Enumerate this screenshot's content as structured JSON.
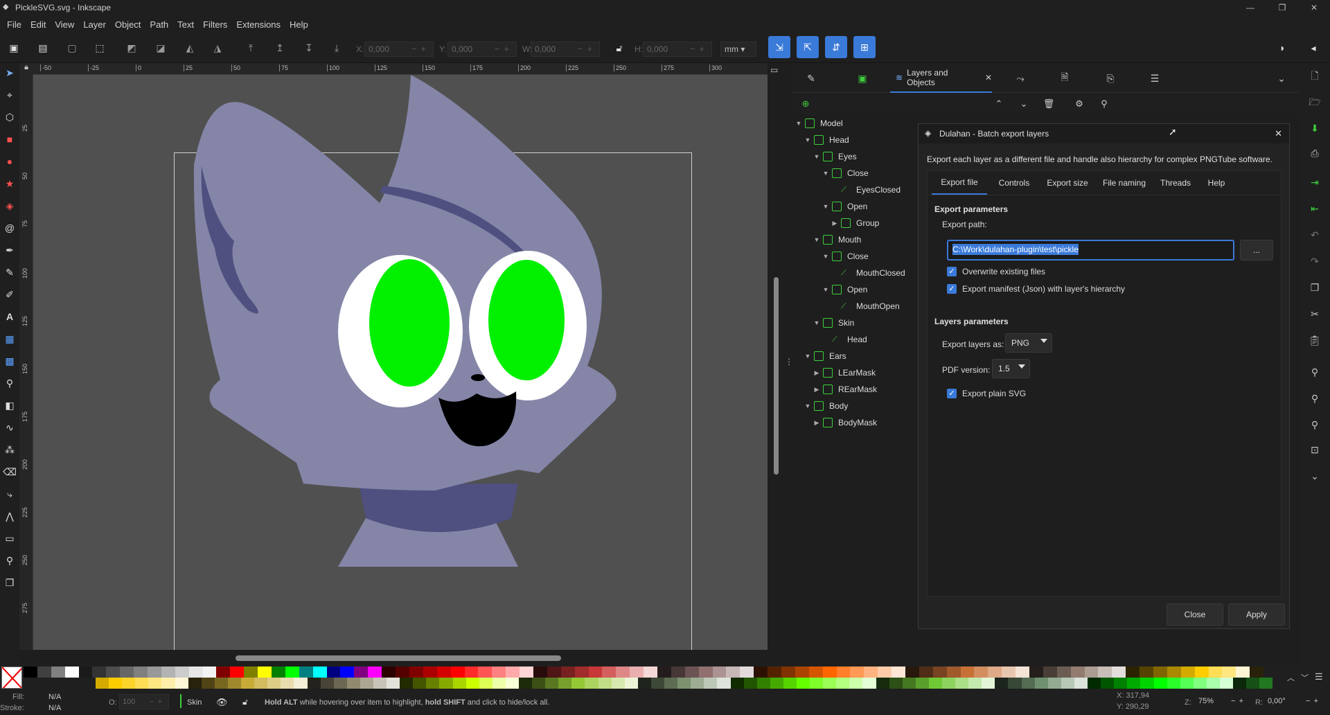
{
  "window": {
    "title": "PickleSVG.svg - Inkscape",
    "minimize": "—",
    "maximize": "❐",
    "close": "✕"
  },
  "menu": [
    "File",
    "Edit",
    "View",
    "Layer",
    "Object",
    "Path",
    "Text",
    "Filters",
    "Extensions",
    "Help"
  ],
  "toolbar": {
    "x_label": "X:",
    "x_value": "0,000",
    "y_label": "Y:",
    "y_value": "0,000",
    "w_label": "W:",
    "w_value": "0,000",
    "h_label": "H:",
    "h_value": "0,000",
    "units": "mm"
  },
  "ruler": {
    "top": [
      "-50",
      "-25",
      "0",
      "25",
      "50",
      "75",
      "100",
      "125",
      "150",
      "175",
      "200",
      "225",
      "250",
      "275",
      "300"
    ],
    "left": [
      "25",
      "50",
      "75",
      "100",
      "125",
      "150",
      "175",
      "200",
      "225",
      "250",
      "275"
    ]
  },
  "dock": {
    "tab_label": "Layers and Objects",
    "tab_close": "✕"
  },
  "tree": [
    {
      "label": "Model",
      "depth": 0,
      "arrow": "open",
      "kind": "layer"
    },
    {
      "label": "Head",
      "depth": 1,
      "arrow": "open",
      "kind": "layer"
    },
    {
      "label": "Eyes",
      "depth": 2,
      "arrow": "open",
      "kind": "layer"
    },
    {
      "label": "Close",
      "depth": 3,
      "arrow": "open",
      "kind": "layer"
    },
    {
      "label": "EyesClosed",
      "depth": 4,
      "arrow": "none",
      "kind": "path"
    },
    {
      "label": "Open",
      "depth": 3,
      "arrow": "open",
      "kind": "layer"
    },
    {
      "label": "Group",
      "depth": 4,
      "arrow": "closed",
      "kind": "layer"
    },
    {
      "label": "Mouth",
      "depth": 2,
      "arrow": "open",
      "kind": "layer"
    },
    {
      "label": "Close",
      "depth": 3,
      "arrow": "open",
      "kind": "layer"
    },
    {
      "label": "MouthClosed",
      "depth": 4,
      "arrow": "none",
      "kind": "path"
    },
    {
      "label": "Open",
      "depth": 3,
      "arrow": "open",
      "kind": "layer"
    },
    {
      "label": "MouthOpen",
      "depth": 4,
      "arrow": "none",
      "kind": "path"
    },
    {
      "label": "Skin",
      "depth": 2,
      "arrow": "open",
      "kind": "layer"
    },
    {
      "label": "Head",
      "depth": 3,
      "arrow": "none",
      "kind": "path"
    },
    {
      "label": "Ears",
      "depth": 1,
      "arrow": "open",
      "kind": "layer"
    },
    {
      "label": "LEarMask",
      "depth": 2,
      "arrow": "closed",
      "kind": "mask"
    },
    {
      "label": "REarMask",
      "depth": 2,
      "arrow": "closed",
      "kind": "mask"
    },
    {
      "label": "Body",
      "depth": 1,
      "arrow": "open",
      "kind": "layer"
    },
    {
      "label": "BodyMask",
      "depth": 2,
      "arrow": "closed",
      "kind": "mask"
    }
  ],
  "dialog": {
    "title": "Dulahan - Batch export layers",
    "close": "✕",
    "description": "Export each layer as a different file and handle also hierarchy for complex PNGTube software.",
    "tabs": [
      "Export file",
      "Controls",
      "Export size",
      "File naming",
      "Threads",
      "Help"
    ],
    "export_params_heading": "Export parameters",
    "export_path_label": "Export path:",
    "export_path_value": "C:\\Work\\dulahan-plugin\\test\\pickle",
    "browse_label": "...",
    "overwrite_label": "Overwrite existing files",
    "manifest_label": "Export manifest (Json) with layer's hierarchy",
    "layers_params_heading": "Layers parameters",
    "export_as_label": "Export layers as:",
    "export_as_value": "PNG",
    "pdf_version_label": "PDF version:",
    "pdf_version_value": "1.5",
    "plain_svg_label": "Export plain SVG",
    "close_button": "Close",
    "apply_button": "Apply",
    "check": "✓"
  },
  "status": {
    "fill_label": "Fill:",
    "fill_value": "N/A",
    "stroke_label": "Stroke:",
    "stroke_value": "N/A",
    "opacity_label": "O:",
    "opacity_value": "100",
    "layer_name": "Skin",
    "message_bold1": "Hold ALT",
    "message_mid": " while hovering over item to highlight, ",
    "message_bold2": "hold SHIFT",
    "message_end": " and click to hide/lock all.",
    "x_coord": "X: 317,94",
    "y_coord": "Y: 290,29",
    "zoom_label": "Z:",
    "zoom_value": "75%",
    "rotation_label": "R:",
    "rotation_value": "0,00°"
  },
  "colors": {
    "accent": "#3a7ad9",
    "character_body": "#8585a8",
    "character_shade": "#4f4f80",
    "eye_green": "#00f000",
    "canvas_bg": "#505050"
  },
  "palette_top": [
    "#000000",
    "#404040",
    "#808080",
    "#ffffff",
    "#1a1a1a",
    "#333",
    "#4d4d4d",
    "#666",
    "#808080",
    "#999",
    "#b3b3b3",
    "#ccc",
    "#e6e6e6",
    "#f2f2f2",
    "#800000",
    "#ff0000",
    "#808000",
    "#ffff00",
    "#008000",
    "#00ff00",
    "#008080",
    "#00ffff",
    "#000080",
    "#0000ff",
    "#800080",
    "#ff00ff",
    "#2b0000",
    "#550000",
    "#800000",
    "#aa0000",
    "#d40000",
    "#ff0000",
    "#ff2a2a",
    "#ff5555",
    "#ff8080",
    "#ffaaaa",
    "#ffd5d5",
    "#280b0b",
    "#501616",
    "#782121",
    "#a02c2c",
    "#c83737",
    "#d35f5f",
    "#de8787",
    "#e9afaf",
    "#f4d7d7",
    "#241c1c",
    "#483737",
    "#6c5353",
    "#916f6f",
    "#ac9393",
    "#c8b7b7",
    "#e3dbdb",
    "#2b1100",
    "#552200",
    "#803300",
    "#aa4400",
    "#d45500",
    "#ff6600",
    "#ff7f2a",
    "#ff9955",
    "#ffb380",
    "#ffccaa",
    "#ffe6d5",
    "#28170b",
    "#502d16",
    "#784421",
    "#a05a2c",
    "#c87137",
    "#d38d5f",
    "#deaa87",
    "#e9c6af",
    "#f4e3d7",
    "#241f1c",
    "#483e37",
    "#6c5d53",
    "#917c6f",
    "#ac9d93",
    "#c8beb7",
    "#e3dedb",
    "#2b2200",
    "#554400",
    "#806600",
    "#aa8800",
    "#d4aa00",
    "#ffcc00",
    "#ffdd55",
    "#ffe680",
    "#fff6d5",
    "#28220b"
  ],
  "palette_bottom": [
    "#d4aa00",
    "#ffcc00",
    "#ffd42a",
    "#ffdd55",
    "#ffe680",
    "#ffeeaa",
    "#fff6d5",
    "#28220b",
    "#504416",
    "#786721",
    "#a0892c",
    "#c8ab37",
    "#d3bc5f",
    "#decd87",
    "#e9ddaf",
    "#f4eed7",
    "#24221c",
    "#484537",
    "#6c6753",
    "#918a6f",
    "#aca793",
    "#c8c4b7",
    "#e3e2db",
    "#222b00",
    "#445500",
    "#668000",
    "#88aa00",
    "#aad400",
    "#ccff00",
    "#ddff55",
    "#eeffaa",
    "#f6ffd5",
    "#1e2b0b",
    "#3c5016",
    "#597821",
    "#77a02c",
    "#94c837",
    "#abd35f",
    "#c1de87",
    "#d8e9af",
    "#eef4d7",
    "#1f241c",
    "#3e4837",
    "#5d6c53",
    "#7c916f",
    "#9dac93",
    "#bec8b7",
    "#dee3db",
    "#112b00",
    "#225500",
    "#338000",
    "#44aa00",
    "#55d400",
    "#66ff00",
    "#7fff2a",
    "#99ff55",
    "#b3ff80",
    "#ccffaa",
    "#e5ffd5",
    "#162b0b",
    "#2d5016",
    "#447821",
    "#5aa02c",
    "#71c837",
    "#8dd35f",
    "#aade87",
    "#c6e9af",
    "#e3f4d7",
    "#1c241c",
    "#374837",
    "#536c53",
    "#6f916f",
    "#93ac93",
    "#b7c8b7",
    "#dbe3db",
    "#002b00",
    "#005500",
    "#008000",
    "#00aa00",
    "#00d400",
    "#00ff00",
    "#2aff2a",
    "#55ff55",
    "#80ff80",
    "#aaffaa",
    "#d5ffd5",
    "#0b280b",
    "#165016",
    "#217821"
  ]
}
